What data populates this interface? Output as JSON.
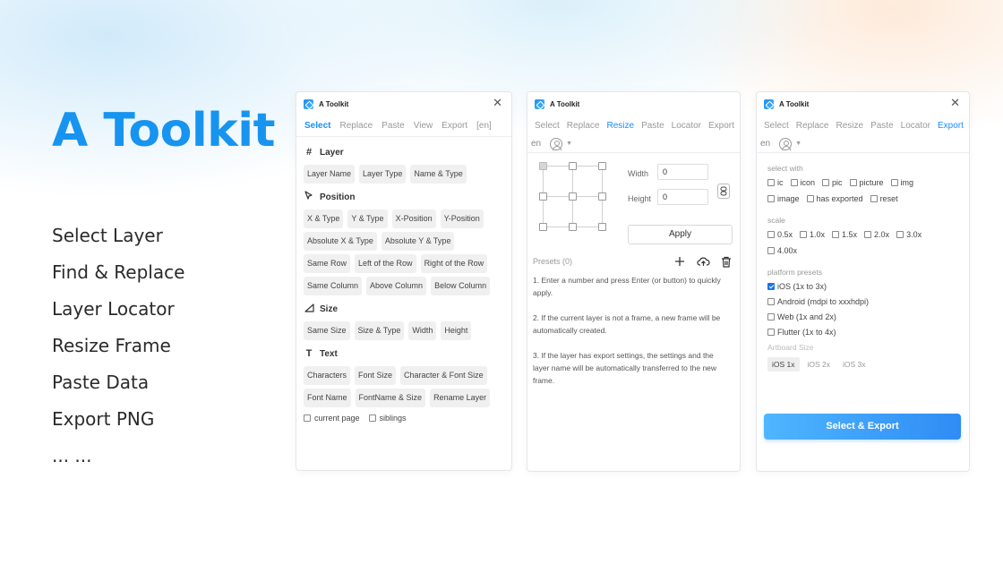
{
  "hero": {
    "title": "A Toolkit",
    "features": [
      "Select Layer",
      "Find & Replace",
      "Layer Locator",
      "Resize Frame",
      "Paste Data",
      "Export PNG",
      "... ..."
    ]
  },
  "app": {
    "title": "A Toolkit"
  },
  "panel1": {
    "tabs": [
      "Select",
      "Replace",
      "Paste",
      "View",
      "Export",
      "[en]"
    ],
    "sections": [
      {
        "title": "Layer",
        "icon": "hash-icon",
        "chips": [
          "Layer Name",
          "Layer Type",
          "Name & Type"
        ]
      },
      {
        "title": "Position",
        "icon": "cursor-icon",
        "chips": [
          "X & Type",
          "Y & Type",
          "X-Position",
          "Y-Position",
          "Absolute X & Type",
          "Absolute Y & Type",
          "Same Row",
          "Left of the Row",
          "Right of the Row",
          "Same Column",
          "Above Column",
          "Below Column"
        ]
      },
      {
        "title": "Size",
        "icon": "triangle-ruler-icon",
        "chips": [
          "Same Size",
          "Size & Type",
          "Width",
          "Height"
        ]
      },
      {
        "title": "Text",
        "icon": "text-icon",
        "chips": [
          "Characters",
          "Font Size",
          "Character & Font Size",
          "Font Name",
          "FontName & Size",
          "Rename Layer"
        ]
      }
    ],
    "checks": [
      {
        "label": "current page",
        "checked": false
      },
      {
        "label": "siblings",
        "checked": false
      }
    ]
  },
  "panel2": {
    "tabs": [
      "Select",
      "Replace",
      "Resize",
      "Paste",
      "Locator",
      "Export"
    ],
    "lang": "en",
    "width_label": "Width",
    "width_value": "0",
    "height_label": "Height",
    "height_value": "0",
    "apply_label": "Apply",
    "presets_label": "Presets (0)",
    "instructions": [
      "1. Enter a number and press Enter (or button) to quickly apply.",
      "2. If the current layer is not a frame, a new frame will be automatically created.",
      "3. If the layer has export settings, the settings and the layer name will be automatically transferred to the new frame."
    ]
  },
  "panel3": {
    "tabs": [
      "Select",
      "Replace",
      "Resize",
      "Paste",
      "Locator",
      "Export"
    ],
    "lang": "en",
    "select_with_label": "select with",
    "select_with": [
      {
        "label": "ic",
        "checked": false
      },
      {
        "label": "icon",
        "checked": false
      },
      {
        "label": "pic",
        "checked": false
      },
      {
        "label": "picture",
        "checked": false
      },
      {
        "label": "img",
        "checked": false
      },
      {
        "label": "image",
        "checked": false
      },
      {
        "label": "has exported",
        "checked": false
      },
      {
        "label": "reset",
        "checked": false
      }
    ],
    "scale_label": "scale",
    "scales": [
      {
        "label": "0.5x",
        "checked": false
      },
      {
        "label": "1.0x",
        "checked": false
      },
      {
        "label": "1.5x",
        "checked": false
      },
      {
        "label": "2.0x",
        "checked": false
      },
      {
        "label": "3.0x",
        "checked": false
      },
      {
        "label": "4.00x",
        "checked": false
      }
    ],
    "platform_label": "platform presets",
    "platforms": [
      {
        "label": "iOS (1x to 3x)",
        "checked": true
      },
      {
        "label": "Android (mdpi to xxxhdpi)",
        "checked": false
      },
      {
        "label": "Web (1x and 2x)",
        "checked": false
      },
      {
        "label": "Flutter (1x to 4x)",
        "checked": false
      }
    ],
    "artboard_label": "Artboard Size",
    "artboard_sizes": [
      "iOS 1x",
      "iOS 2x",
      "iOS 3x"
    ],
    "artboard_active": "iOS 1x",
    "export_label": "Select & Export"
  },
  "colors": {
    "accent": "#1890ff",
    "hero_title": "#1794f0",
    "export_button": "#2f8cf4"
  }
}
